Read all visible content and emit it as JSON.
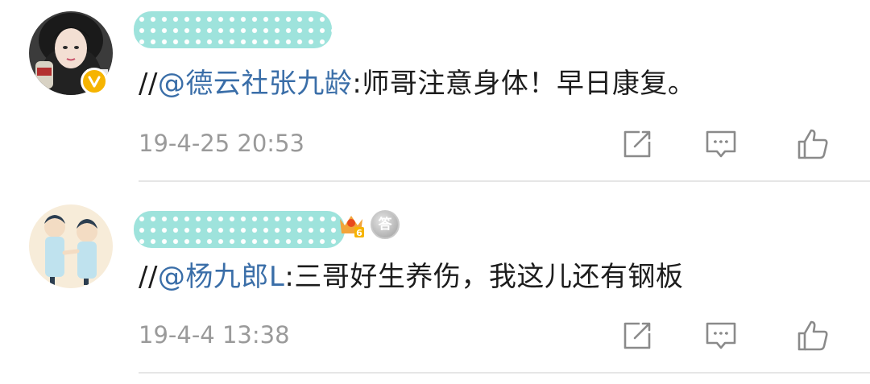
{
  "comments": [
    {
      "avatar": "user-avatar-photo",
      "badges": [
        "verified-badge"
      ],
      "text_prefix": "//",
      "mention": "@德云社张九龄",
      "text": ":师哥注意身体！早日康复。",
      "timestamp": "19-4-25 20:53",
      "actions": [
        "share-icon",
        "reply-icon",
        "like-icon"
      ]
    },
    {
      "avatar": "user-avatar-illustration",
      "badges": [
        "fan-level-badge",
        "medal-badge"
      ],
      "medal_label": "答",
      "fan_level": "6",
      "text_prefix": "//",
      "mention": "@杨九郎L",
      "text": ":三哥好生养伤，我这儿还有钢板",
      "timestamp": "19-4-4 13:38",
      "actions": [
        "share-icon",
        "reply-icon",
        "like-icon"
      ]
    }
  ],
  "colors": {
    "mention": "#3a6ea8",
    "text": "#1c1c1c",
    "timestamp": "#9a9a9a",
    "name_mask": "#9ee3dc",
    "verified": "#f6b400",
    "icon": "#8a8a8a"
  }
}
